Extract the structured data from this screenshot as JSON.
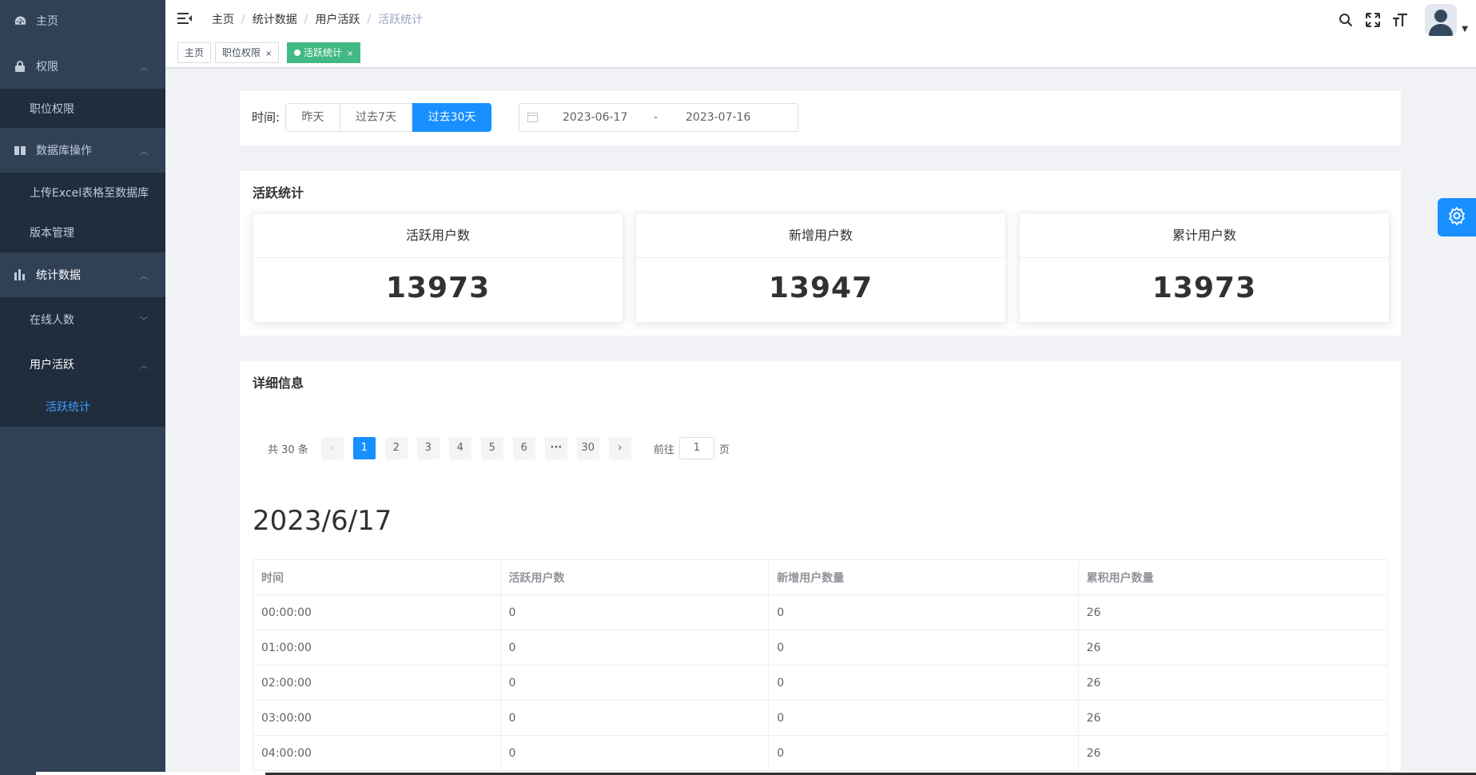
{
  "sidebar": {
    "items": [
      {
        "label": "主页",
        "icon": "dashboard-icon"
      },
      {
        "label": "权限",
        "icon": "lock-icon"
      },
      {
        "label": "职位权限"
      },
      {
        "label": "数据库操作",
        "icon": "book-icon"
      },
      {
        "label": "上传Excel表格至数据库"
      },
      {
        "label": "版本管理"
      },
      {
        "label": "统计数据",
        "icon": "chart-icon"
      },
      {
        "label": "在线人数"
      },
      {
        "label": "用户活跃"
      },
      {
        "label": "活跃统计"
      }
    ]
  },
  "header": {
    "breadcrumb": [
      "主页",
      "统计数据",
      "用户活跃",
      "活跃统计"
    ],
    "icons": [
      "search-icon",
      "fullscreen-icon",
      "font-size-icon"
    ]
  },
  "tags": [
    {
      "label": "主页"
    },
    {
      "label": "职位权限",
      "close": "×"
    },
    {
      "label": "活跃统计",
      "close": "×",
      "active": true
    }
  ],
  "filter": {
    "time_label": "时间:",
    "buttons": [
      "昨天",
      "过去7天",
      "过去30天"
    ],
    "selected": "过去30天",
    "range_start": "2023-06-17",
    "range_sep": "-",
    "range_end": "2023-07-16"
  },
  "stats": {
    "title": "活跃统计",
    "cards": [
      {
        "label": "活跃用户数",
        "value": "13973"
      },
      {
        "label": "新增用户数",
        "value": "13947"
      },
      {
        "label": "累计用户数",
        "value": "13973"
      }
    ]
  },
  "detail": {
    "title": "详细信息",
    "pagination": {
      "total": "共 30 条",
      "prev": "‹",
      "pages": [
        "1",
        "2",
        "3",
        "4",
        "5",
        "6",
        "···",
        "30"
      ],
      "next": "›",
      "goto_prefix": "前往",
      "goto_value": "1",
      "goto_suffix": "页"
    },
    "date": "2023/6/17",
    "columns": [
      "时间",
      "活跃用户数",
      "新增用户数量",
      "累积用户数量"
    ],
    "rows": [
      [
        "00:00:00",
        "0",
        "0",
        "26"
      ],
      [
        "01:00:00",
        "0",
        "0",
        "26"
      ],
      [
        "02:00:00",
        "0",
        "0",
        "26"
      ],
      [
        "03:00:00",
        "0",
        "0",
        "26"
      ],
      [
        "04:00:00",
        "0",
        "0",
        "26"
      ]
    ]
  },
  "colors": {
    "sidebar_bg": "#304156",
    "submenu_bg": "#1f2d3d",
    "primary": "#1890ff",
    "tag_active": "#42b983"
  }
}
